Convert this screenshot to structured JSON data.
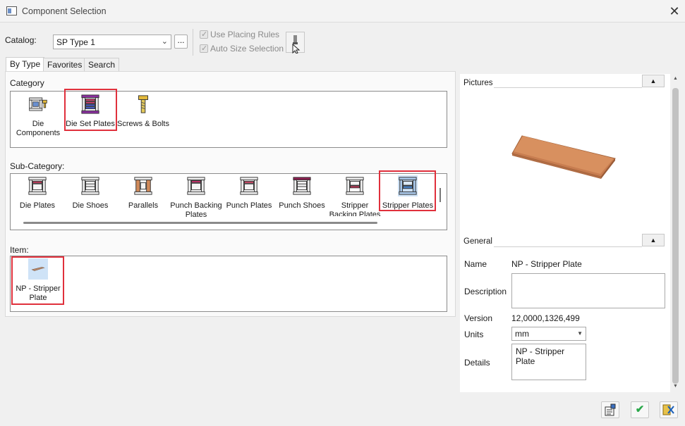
{
  "window": {
    "title": "Component Selection"
  },
  "catalog": {
    "label": "Catalog:",
    "value": "SP Type 1",
    "browse_label": "..."
  },
  "options": {
    "use_placing_rules": "Use Placing Rules",
    "auto_size_selection": "Auto Size Selection"
  },
  "tabs": [
    {
      "label": "By Type"
    },
    {
      "label": "Favorites"
    },
    {
      "label": "Search"
    }
  ],
  "category": {
    "title": "Category",
    "items": [
      {
        "label": "Die Components",
        "icon": "die-components-icon"
      },
      {
        "label": "Die Set Plates",
        "icon": "die-set-plates-icon"
      },
      {
        "label": "Screws & Bolts",
        "icon": "screw-bolt-icon"
      }
    ]
  },
  "subcategory": {
    "title": "Sub-Category:",
    "items": [
      {
        "label": "Die Plates"
      },
      {
        "label": "Die Shoes"
      },
      {
        "label": "Parallels"
      },
      {
        "label": "Punch Backing Plates"
      },
      {
        "label": "Punch Plates"
      },
      {
        "label": "Punch Shoes"
      },
      {
        "label": "Stripper Backing Plates"
      },
      {
        "label": "Stripper Plates"
      }
    ]
  },
  "item": {
    "title": "Item:",
    "items": [
      {
        "label": "NP - Stripper Plate"
      }
    ]
  },
  "pictures": {
    "title": "Pictures"
  },
  "general": {
    "title": "General",
    "name_label": "Name",
    "name_value": "NP - Stripper Plate",
    "description_label": "Description",
    "description_value": "",
    "version_label": "Version",
    "version_value": "12,0000,1326,499",
    "units_label": "Units",
    "units_value": "mm",
    "details_label": "Details",
    "details_value": "NP - Stripper Plate"
  },
  "colors": {
    "highlight": "#e0303c",
    "plate": "#d88a5a",
    "ok_green": "#2aa84a"
  }
}
